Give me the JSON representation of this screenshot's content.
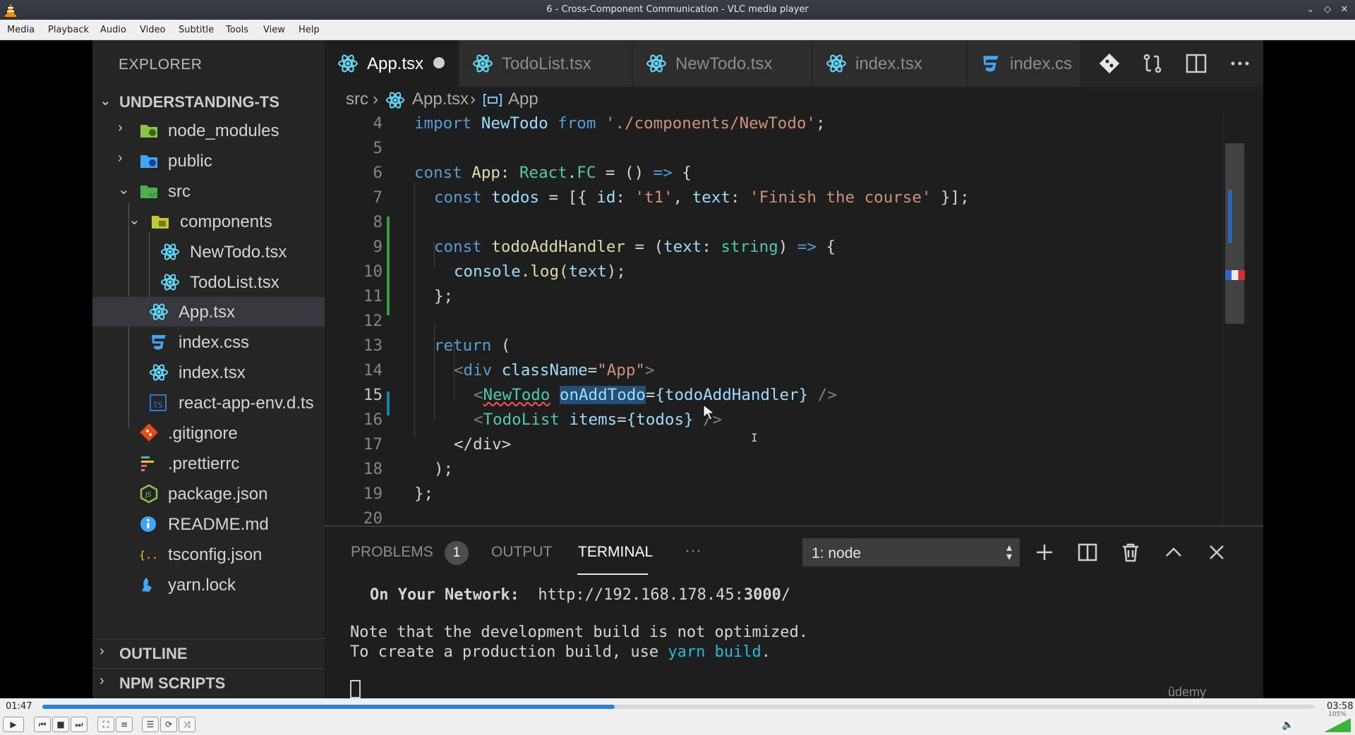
{
  "window": {
    "title": "6 - Cross-Component Communication - VLC media player",
    "buttons": {
      "minimize": "⌄",
      "restore": "◇",
      "close": "✕"
    }
  },
  "menu": [
    "Media",
    "Playback",
    "Audio",
    "Video",
    "Subtitle",
    "Tools",
    "View",
    "Help"
  ],
  "vscode": {
    "explorer_title": "EXPLORER",
    "project_name": "UNDERSTANDING-TS",
    "tree": [
      {
        "label": "node_modules",
        "icon": "folder-node-icon",
        "chevron": "›"
      },
      {
        "label": "public",
        "icon": "folder-public-icon",
        "chevron": "›"
      },
      {
        "label": "src",
        "icon": "folder-src-icon",
        "chevron": "⌄"
      },
      {
        "label": "components",
        "icon": "folder-components-icon",
        "chevron": "⌄"
      },
      {
        "label": "NewTodo.tsx",
        "icon": "react-icon"
      },
      {
        "label": "TodoList.tsx",
        "icon": "react-icon"
      },
      {
        "label": "App.tsx",
        "icon": "react-icon"
      },
      {
        "label": "index.css",
        "icon": "css-icon"
      },
      {
        "label": "index.tsx",
        "icon": "react-icon"
      },
      {
        "label": "react-app-env.d.ts",
        "icon": "typescript-icon"
      },
      {
        "label": ".gitignore",
        "icon": "git-icon"
      },
      {
        "label": ".prettierrc",
        "icon": "prettier-icon"
      },
      {
        "label": "package.json",
        "icon": "nodejs-icon"
      },
      {
        "label": "README.md",
        "icon": "info-icon"
      },
      {
        "label": "tsconfig.json",
        "icon": "json-icon"
      },
      {
        "label": "yarn.lock",
        "icon": "yarn-icon"
      }
    ],
    "sections": [
      "OUTLINE",
      "NPM SCRIPTS"
    ],
    "tabs": [
      {
        "label": "App.tsx",
        "icon": "react-icon",
        "active": true,
        "dirty": true
      },
      {
        "label": "TodoList.tsx",
        "icon": "react-icon"
      },
      {
        "label": "NewTodo.tsx",
        "icon": "react-icon"
      },
      {
        "label": "index.tsx",
        "icon": "react-icon"
      },
      {
        "label": "index.cs",
        "icon": "css-icon"
      }
    ],
    "breadcrumb": {
      "folder": "src",
      "file": "App.tsx",
      "symbol": "App",
      "separator": "›"
    },
    "line_numbers": [
      "4",
      "5",
      "6",
      "7",
      "8",
      "9",
      "10",
      "11",
      "12",
      "13",
      "14",
      "15",
      "16",
      "17",
      "18",
      "19",
      "20"
    ],
    "code": {
      "l4_import": "import",
      "l4_name": "NewTodo",
      "l4_from": "from",
      "l4_path": "'./components/NewTodo'",
      "l4_end": ";",
      "l6_const": "const",
      "l6_name": "App",
      "l6_colon": ": ",
      "l6_react": "React",
      "l6_dot": ".",
      "l6_fc": "FC",
      "l6_eq": " = () ",
      "l6_arrow": "=>",
      "l6_brace": " {",
      "l7_const": "const",
      "l7_name": "todos",
      "l7_a": " = [{ ",
      "l7_id": "id",
      "l7_b": ": ",
      "l7_t1": "'t1'",
      "l7_c": ", ",
      "l7_text": "text",
      "l7_d": ": ",
      "l7_str": "'Finish the course'",
      "l7_e": " }];",
      "l9_const": "const",
      "l9_name": "todoAddHandler",
      "l9_a": " = (",
      "l9_text": "text",
      "l9_b": ": ",
      "l9_type": "string",
      "l9_c": ") ",
      "l9_arrow": "=>",
      "l9_d": " {",
      "l10_console": "console",
      "l10_dot": ".",
      "l10_log": "log",
      "l10_a": "(",
      "l10_text": "text",
      "l10_b": ");",
      "l11": "};",
      "l13_return": "return",
      "l13_a": " (",
      "l14_lt": "<",
      "l14_tag": "div",
      "l14_attr": "className",
      "l14_eq": "=",
      "l14_val": "\"App\"",
      "l14_gt": ">",
      "l15_lt": "<",
      "l15_tag": "NewTodo",
      "l15_attr": "onAddTodo",
      "l15_eq": "=",
      "l15_val": "{todoAddHandler}",
      "l15_end": " />",
      "l16_lt": "<",
      "l16_tag": "TodoList",
      "l16_attr": "items",
      "l16_eq": "=",
      "l16_val": "{todos}",
      "l16_end": " />",
      "l17": "</div>",
      "l18": ");",
      "l19": "};"
    },
    "panel": {
      "tabs": [
        "PROBLEMS",
        "OUTPUT",
        "TERMINAL"
      ],
      "problems_count": "1",
      "more": "···",
      "terminal_select": "1: node",
      "terminal": {
        "network_label": "On Your Network:",
        "network_url_a": "http://192.168.178.45:",
        "network_url_port": "3000",
        "network_url_b": "/",
        "note1": "Note that the development build is not optimized.",
        "note2_a": "To create a production build, use ",
        "note2_cmd": "yarn build",
        "note2_b": "."
      }
    },
    "watermark": "ûdemy"
  },
  "player": {
    "elapsed": "01:47",
    "total": "03:58",
    "progress": 0.45,
    "volume_label": "105%",
    "volume": 1.05,
    "colors": {
      "seek_fill": "#2a83d6",
      "volume": "#3cb43c"
    }
  }
}
